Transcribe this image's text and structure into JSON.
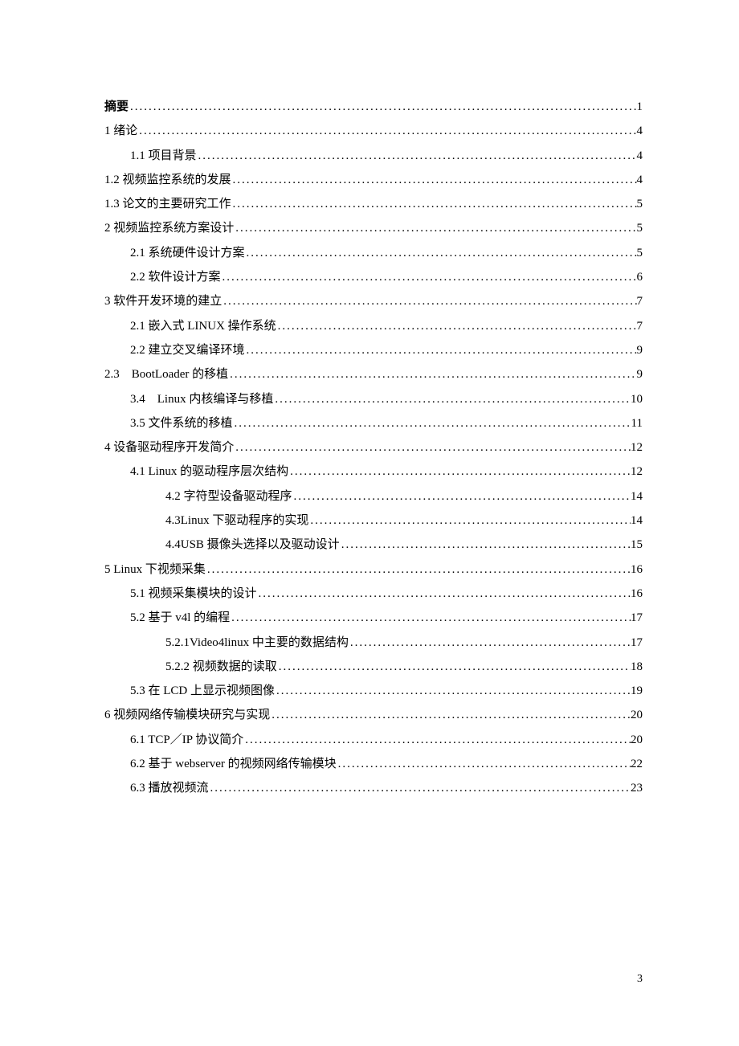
{
  "toc": [
    {
      "title": "摘要",
      "page": "1",
      "indent": 0,
      "bold": true
    },
    {
      "title": "1 绪论",
      "page": "4",
      "indent": 0
    },
    {
      "title": "1.1 项目背景",
      "page": "4",
      "indent": 1
    },
    {
      "title": "1.2 视频监控系统的发展",
      "page": "4",
      "indent": 0
    },
    {
      "title": "1.3 论文的主要研究工作",
      "page": "5",
      "indent": 0
    },
    {
      "title": "2 视频监控系统方案设计",
      "page": "5",
      "indent": 0
    },
    {
      "title": "2.1 系统硬件设计方案",
      "page": "5",
      "indent": 1
    },
    {
      "title": "2.2 软件设计方案",
      "page": "6",
      "indent": 1
    },
    {
      "title": "3 软件开发环境的建立",
      "page": "7",
      "indent": 0
    },
    {
      "title": "2.1 嵌入式 LINUX 操作系统",
      "page": "7",
      "indent": 1
    },
    {
      "title": "2.2 建立交叉编译环境",
      "page": "9",
      "indent": 1
    },
    {
      "title": "2.3　BootLoader 的移植",
      "page": "9",
      "indent": 0
    },
    {
      "title": "3.4　Linux 内核编译与移植",
      "page": "10",
      "indent": 1
    },
    {
      "title": "3.5 文件系统的移植",
      "page": "11",
      "indent": 1
    },
    {
      "title": "4 设备驱动程序开发简介",
      "page": "12",
      "indent": 0
    },
    {
      "title": "4.1 Linux 的驱动程序层次结构",
      "page": "12",
      "indent": 1
    },
    {
      "title": "4.2 字符型设备驱动程序",
      "page": "14",
      "indent": 2
    },
    {
      "title": "4.3Linux 下驱动程序的实现",
      "page": "14",
      "indent": 2
    },
    {
      "title": "4.4USB 摄像头选择以及驱动设计",
      "page": "15",
      "indent": 2
    },
    {
      "title": "5 Linux 下视频采集",
      "page": "16",
      "indent": 0
    },
    {
      "title": "5.1 视频采集模块的设计",
      "page": "16",
      "indent": 1
    },
    {
      "title": "5.2 基于 v4l 的编程",
      "page": "17",
      "indent": 1
    },
    {
      "title": "5.2.1Video4linux 中主要的数据结构",
      "page": "17",
      "indent": 2
    },
    {
      "title": "5.2.2 视频数据的读取",
      "page": "18",
      "indent": 2
    },
    {
      "title": "5.3 在 LCD 上显示视频图像",
      "page": "19",
      "indent": 1
    },
    {
      "title": "6 视频网络传输模块研究与实现",
      "page": "20",
      "indent": 0
    },
    {
      "title": "6.1 TCP／IP 协议简介",
      "page": "20",
      "indent": 1
    },
    {
      "title": "6.2 基于 webserver 的视频网络传输模块",
      "page": "22",
      "indent": 1
    },
    {
      "title": "6.3 播放视频流",
      "page": "23",
      "indent": 1
    }
  ],
  "footer": {
    "page_number": "3"
  }
}
